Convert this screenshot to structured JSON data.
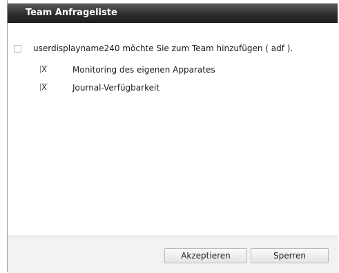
{
  "dialog": {
    "title": "Team Anfrageliste"
  },
  "request": {
    "text": "userdisplayname240 möchte Sie zum Team hinzufügen ( adf ).",
    "checked": false,
    "permissions": [
      {
        "label": "Monitoring des eigenen Apparates",
        "mark": "X",
        "checked": true
      },
      {
        "label": "Journal-Verfügbarkeit",
        "mark": "X",
        "checked": true
      }
    ]
  },
  "footer": {
    "accept_label": "Akzeptieren",
    "block_label": "Sperren"
  }
}
